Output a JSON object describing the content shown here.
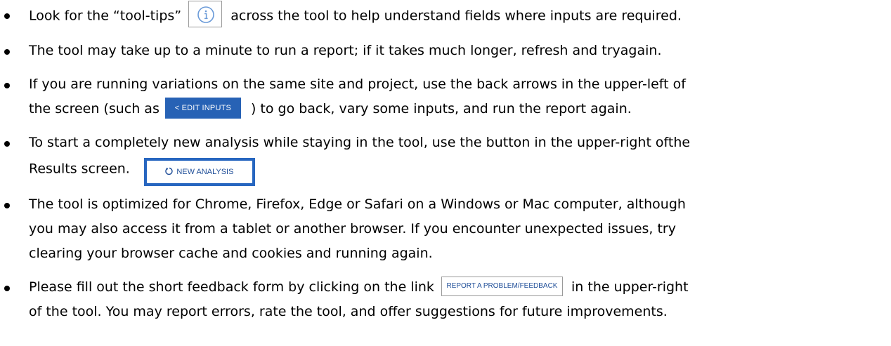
{
  "bullets": [
    {
      "before": "Look for the “tool-tips”",
      "after": "across the tool to help understand fields where inputs are required."
    },
    {
      "text": "The tool may take up to a minute to run a report; if it takes much longer, refresh and tryagain."
    },
    {
      "line1": "If you are running variations on the same site and project, use the back arrows in the upper-left of",
      "before": "the screen (such as",
      "after": ") to go back, vary some inputs, and run the report again."
    },
    {
      "line1": "To start a completely new analysis while staying in the tool, use the button in the upper-right ofthe",
      "before": "Results screen."
    },
    {
      "line1": "The tool is optimized for Chrome, Firefox, Edge or Safari on a Windows or Mac computer, although",
      "line2": "you may also access it from a tablet or another browser. If you encounter unexpected issues, try",
      "line3": "clearing your browser cache and cookies and running again."
    },
    {
      "before": "Please fill out the short feedback form by clicking on the link",
      "after": "in the upper-right",
      "line2": "of the tool. You may report errors, rate the tool, and offer suggestions for future improvements."
    }
  ],
  "buttons": {
    "edit_inputs": "< EDIT INPUTS",
    "new_analysis": "NEW ANALYSIS",
    "report_problem": "REPORT A PROBLEM/FEEDBACK"
  },
  "icons": {
    "tooltip": "info-icon",
    "new_analysis": "refresh-icon"
  },
  "colors": {
    "accent_blue": "#2762b5",
    "icon_blue": "#6a9ad8"
  }
}
